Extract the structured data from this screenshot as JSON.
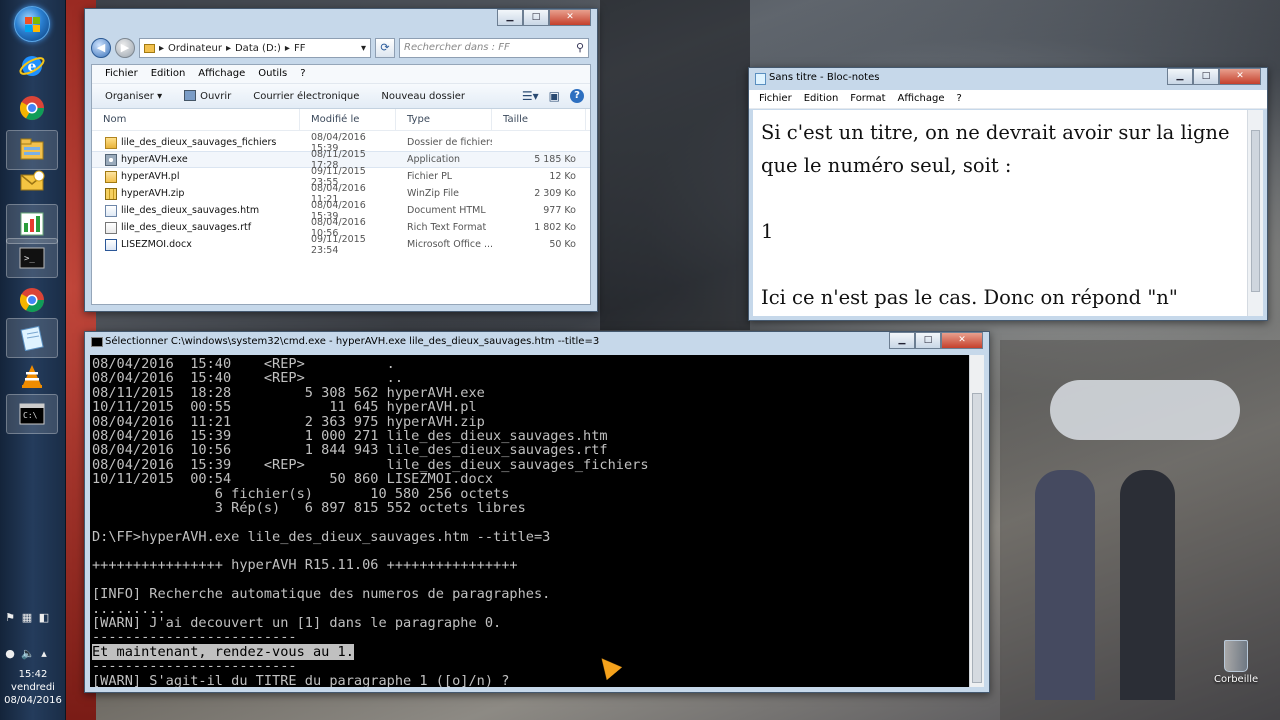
{
  "explorer": {
    "breadcrumb": [
      "Ordinateur",
      "Data (D:)",
      "FF"
    ],
    "search_placeholder": "Rechercher dans : FF",
    "menu": [
      "Fichier",
      "Edition",
      "Affichage",
      "Outils",
      "?"
    ],
    "toolbar": {
      "organize": "Organiser",
      "open": "Ouvrir",
      "email": "Courrier électronique",
      "new_folder": "Nouveau dossier"
    },
    "columns": [
      "Nom",
      "Modifié le",
      "Type",
      "Taille"
    ],
    "files": [
      {
        "name": "lile_des_dieux_sauvages_fichiers",
        "date": "08/04/2016 15:39",
        "type": "Dossier de fichiers",
        "size": "",
        "icon": "folder-icon"
      },
      {
        "name": "hyperAVH.exe",
        "date": "08/11/2015 17:28",
        "type": "Application",
        "size": "5 185 Ko",
        "icon": "exe-icon"
      },
      {
        "name": "hyperAVH.pl",
        "date": "09/11/2015 23:55",
        "type": "Fichier PL",
        "size": "12 Ko",
        "icon": "pl-icon"
      },
      {
        "name": "hyperAVH.zip",
        "date": "08/04/2016 11:21",
        "type": "WinZip File",
        "size": "2 309 Ko",
        "icon": "zip-icon"
      },
      {
        "name": "lile_des_dieux_sauvages.htm",
        "date": "08/04/2016 15:39",
        "type": "Document HTML",
        "size": "977 Ko",
        "icon": "htm-icon"
      },
      {
        "name": "lile_des_dieux_sauvages.rtf",
        "date": "08/04/2016 10:56",
        "type": "Rich Text Format",
        "size": "1 802 Ko",
        "icon": "rtf-icon"
      },
      {
        "name": "LISEZMOI.docx",
        "date": "09/11/2015 23:54",
        "type": "Microsoft Office ...",
        "size": "50 Ko",
        "icon": "docx-icon"
      }
    ]
  },
  "notepad": {
    "title": "Sans titre - Bloc-notes",
    "menu": [
      "Fichier",
      "Edition",
      "Format",
      "Affichage",
      "?"
    ],
    "lines": [
      "Si c'est un titre, on ne devrait avoir sur la ligne",
      "que le numéro seul, soit :",
      "",
      "1",
      "",
      "Ici ce n'est pas le cas. Donc on répond \"n\""
    ]
  },
  "cmd": {
    "title": "Sélectionner C:\\windows\\system32\\cmd.exe - hyperAVH.exe  lile_des_dieux_sauvages.htm --title=3",
    "lines": [
      "08/04/2016  15:40    <REP>          .",
      "08/04/2016  15:40    <REP>          ..",
      "08/11/2015  18:28         5 308 562 hyperAVH.exe",
      "10/11/2015  00:55            11 645 hyperAVH.pl",
      "08/04/2016  11:21         2 363 975 hyperAVH.zip",
      "08/04/2016  15:39         1 000 271 lile_des_dieux_sauvages.htm",
      "08/04/2016  10:56         1 844 943 lile_des_dieux_sauvages.rtf",
      "08/04/2016  15:39    <REP>          lile_des_dieux_sauvages_fichiers",
      "10/11/2015  00:54            50 860 LISEZMOI.docx",
      "               6 fichier(s)       10 580 256 octets",
      "               3 Rép(s)   6 897 815 552 octets libres",
      "",
      "D:\\FF>hyperAVH.exe lile_des_dieux_sauvages.htm --title=3",
      "",
      "++++++++++++++++ hyperAVH R15.11.06 ++++++++++++++++",
      "",
      "[INFO] Recherche automatique des numeros de paragraphes.",
      ".........",
      "[WARN] J'ai decouvert un [1] dans le paragraphe 0.",
      "-------------------------",
      "Et maintenant, rendez-vous au 1.",
      "-------------------------",
      "[WARN] S'agit-il du TITRE du paragraphe 1 ([o]/n) ?"
    ],
    "highlight_line": "Et maintenant, rendez-vous au 1."
  },
  "tray": {
    "time": "15:42",
    "day": "vendredi",
    "date": "08/04/2016"
  },
  "desktop": {
    "recycle_label": "Corbeille"
  },
  "taskbar_icons": [
    "start-orb-icon",
    "internet-explorer-icon",
    "chrome-icon",
    "file-explorer-icon",
    "outlook-icon",
    "hyperavh-app-icon",
    "console-icon",
    "chrome-icon",
    "notepad-icon",
    "vlc-icon",
    "cmd-icon"
  ],
  "colors": {
    "console_bg": "#000000",
    "console_fg": "#c0c0c0",
    "close_button": "#c5402c",
    "taskbar": "#1a2d47"
  }
}
